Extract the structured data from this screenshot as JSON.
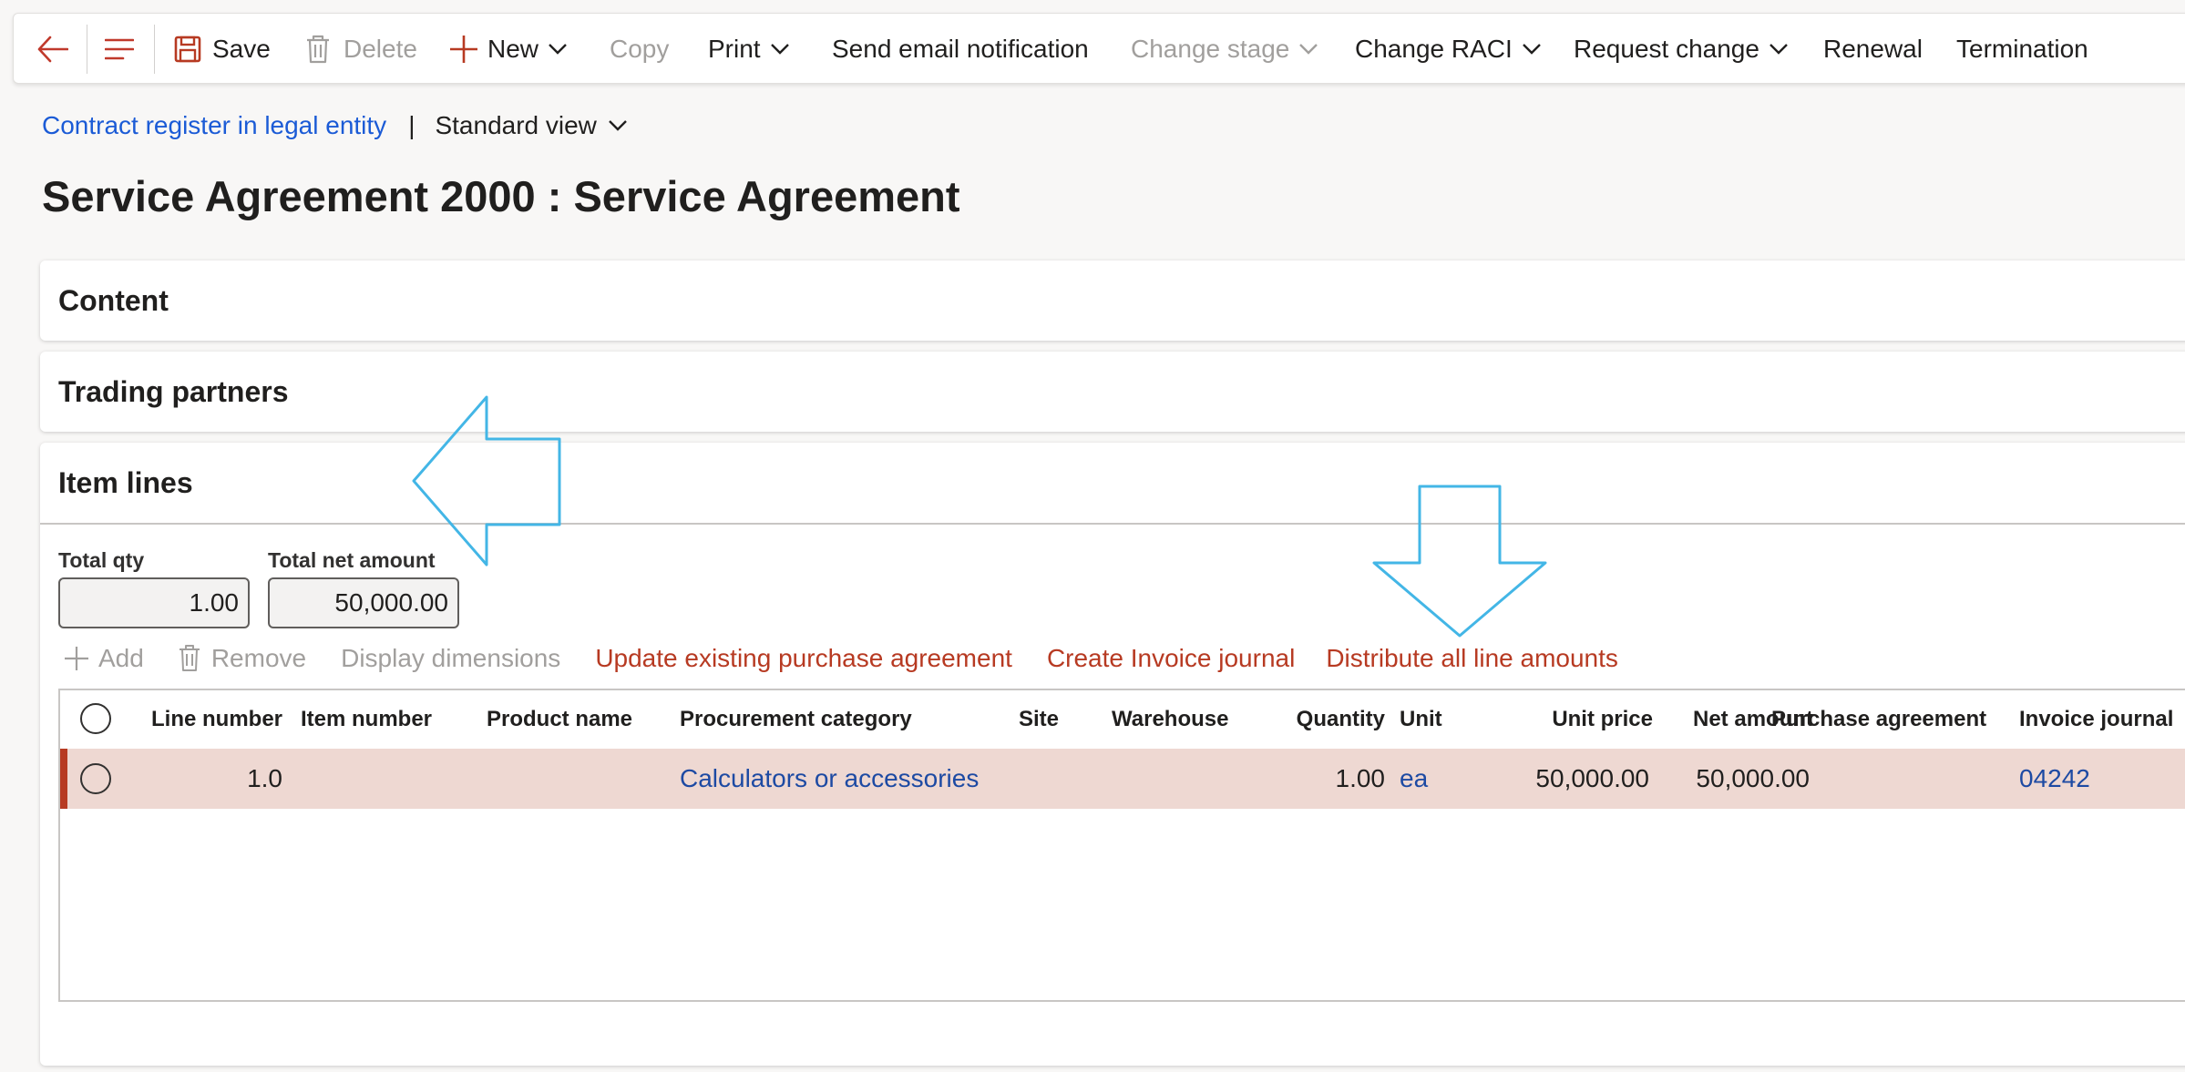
{
  "actionbar": {
    "save": "Save",
    "delete": "Delete",
    "new": "New",
    "copy": "Copy",
    "print": "Print",
    "send_email": "Send email notification",
    "change_stage": "Change stage",
    "change_raci": "Change RACI",
    "request_change": "Request change",
    "renewal": "Renewal",
    "termination": "Termination"
  },
  "breadcrumb": {
    "link": "Contract register in legal entity",
    "separator": "|",
    "view": "Standard view"
  },
  "page_title": "Service Agreement 2000 : Service Agreement",
  "sections": {
    "content": "Content",
    "trading_partners": "Trading partners",
    "item_lines": "Item lines"
  },
  "totals": {
    "qty_label": "Total qty",
    "qty_value": "1.00",
    "net_label": "Total net amount",
    "net_value": "50,000.00"
  },
  "grid_toolbar": {
    "add": "Add",
    "remove": "Remove",
    "display_dimensions": "Display dimensions",
    "update_agreement": "Update existing purchase agreement",
    "create_invoice": "Create Invoice journal",
    "distribute": "Distribute all line amounts"
  },
  "grid": {
    "columns": {
      "line_number": "Line number",
      "item_number": "Item number",
      "product_name": "Product name",
      "procurement_category": "Procurement category",
      "site": "Site",
      "warehouse": "Warehouse",
      "quantity": "Quantity",
      "unit": "Unit",
      "unit_price": "Unit price",
      "net_amount": "Net amount",
      "purchase_agreement": "Purchase agreement",
      "invoice_journal": "Invoice journal"
    },
    "rows": [
      {
        "line_number": "1.0",
        "item_number": "",
        "product_name": "",
        "procurement_category": "Calculators or accessories",
        "site": "",
        "warehouse": "",
        "quantity": "1.00",
        "unit": "ea",
        "unit_price": "50,000.00",
        "net_amount": "50,000.00",
        "purchase_agreement": "",
        "invoice_journal": "04242"
      }
    ]
  },
  "colors": {
    "accent_red": "#b73a22",
    "link_blue": "#1b5bd6",
    "selected_row": "#eed8d2",
    "annotation_arrow": "#43b6e6"
  },
  "icons": [
    "back-arrow-icon",
    "hamburger-menu-icon",
    "save-icon",
    "delete-trash-icon",
    "plus-icon",
    "chevron-down-icon",
    "radio-circle-icon",
    "left-arrow-annotation",
    "down-arrow-annotation"
  ]
}
